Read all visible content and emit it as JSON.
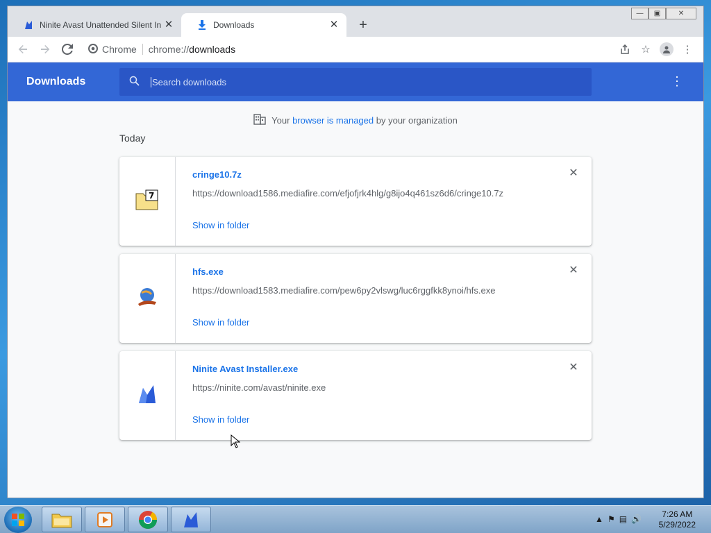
{
  "browser": {
    "tabs": [
      {
        "title": "Ninite Avast Unattended Silent In",
        "icon": "ninite-icon",
        "active": false
      },
      {
        "title": "Downloads",
        "icon": "download-icon",
        "active": true
      }
    ],
    "new_tab_symbol": "+",
    "omnibox": {
      "chip": "Chrome",
      "url_scheme": "chrome://",
      "url_path": "downloads"
    }
  },
  "page": {
    "title": "Downloads",
    "search_placeholder": "Search downloads",
    "managed": {
      "prefix": "Your",
      "link": "browser is managed",
      "suffix": "by your organization"
    },
    "section_label": "Today",
    "downloads": [
      {
        "name": "cringe10.7z",
        "url": "https://download1586.mediafire.com/efjofjrk4hlg/g8ijo4q461sz6d6/cringe10.7z",
        "action": "Show in folder",
        "icon": "7z-archive-icon"
      },
      {
        "name": "hfs.exe",
        "url": "https://download1583.mediafire.com/pew6py2vlswg/luc6rggfkk8ynoi/hfs.exe",
        "action": "Show in folder",
        "icon": "hfs-app-icon"
      },
      {
        "name": "Ninite Avast Installer.exe",
        "url": "https://ninite.com/avast/ninite.exe",
        "action": "Show in folder",
        "icon": "ninite-app-icon"
      }
    ]
  },
  "taskbar": {
    "items": [
      "file-explorer-icon",
      "media-player-icon",
      "chrome-icon",
      "ninite-icon"
    ],
    "time": "7:26 AM",
    "date": "5/29/2022"
  },
  "colors": {
    "header": "#3367d6",
    "link": "#1a73e8",
    "search_bg": "#2a56c6"
  }
}
